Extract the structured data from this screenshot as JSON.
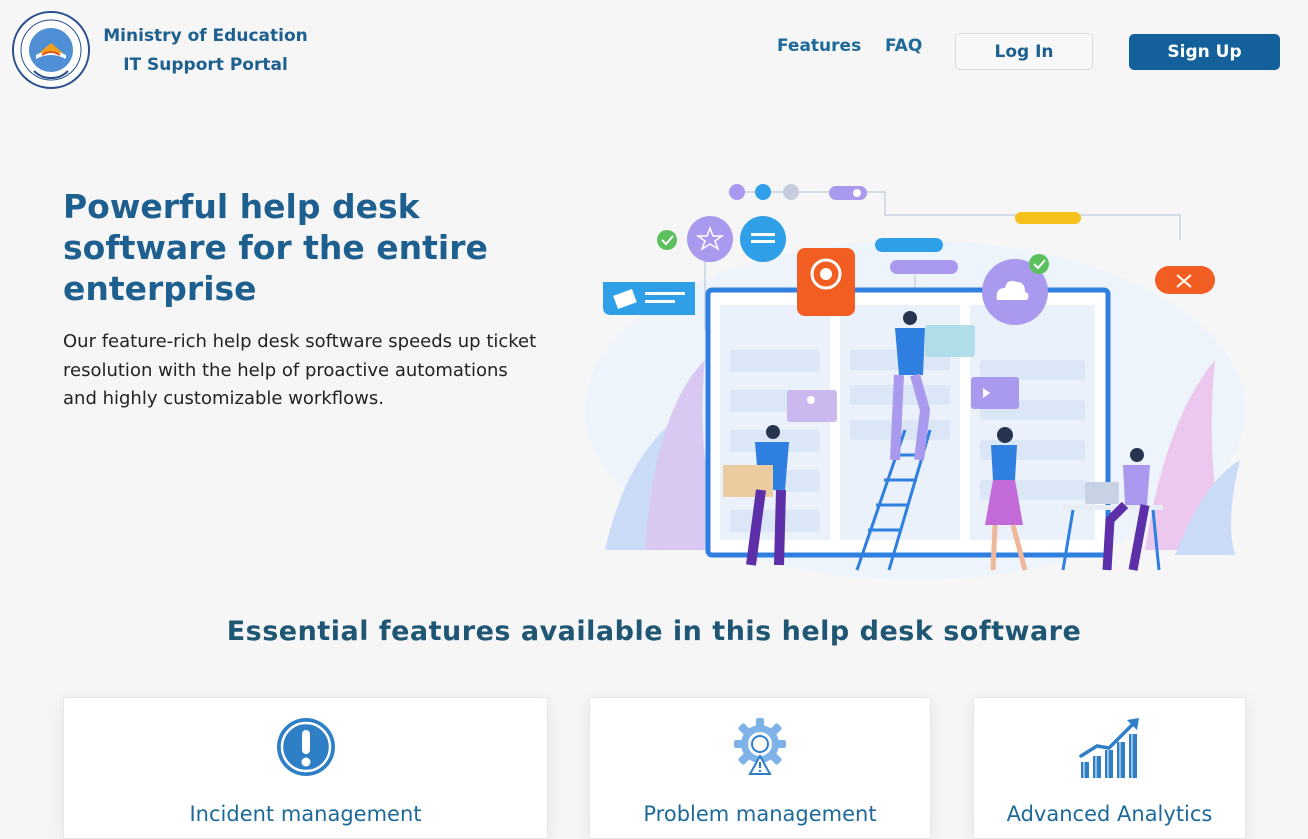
{
  "header": {
    "brand_line1": "Ministry of Education",
    "brand_line2": "IT Support Portal",
    "logo_text": "MINISTRY OF EDUCATION",
    "nav_features": "Features",
    "nav_faq": "FAQ",
    "login_label": "Log In",
    "signup_label": "Sign Up"
  },
  "hero": {
    "title": "Powerful help desk software for the entire enterprise",
    "description": "Our feature-rich help desk software speeds up ticket resolution with the help of proactive automations and highly customizable workflows."
  },
  "features": {
    "title": "Essential features available in this help desk software",
    "cards": [
      {
        "label": "Incident management",
        "icon": "exclamation-icon"
      },
      {
        "label": "Problem management",
        "icon": "gear-warning-icon"
      },
      {
        "label": "Advanced Analytics",
        "icon": "bar-chart-icon"
      }
    ]
  },
  "colors": {
    "brand_blue": "#1d5f8f",
    "signup_bg": "#14609a",
    "page_bg": "#f6f6f6"
  }
}
